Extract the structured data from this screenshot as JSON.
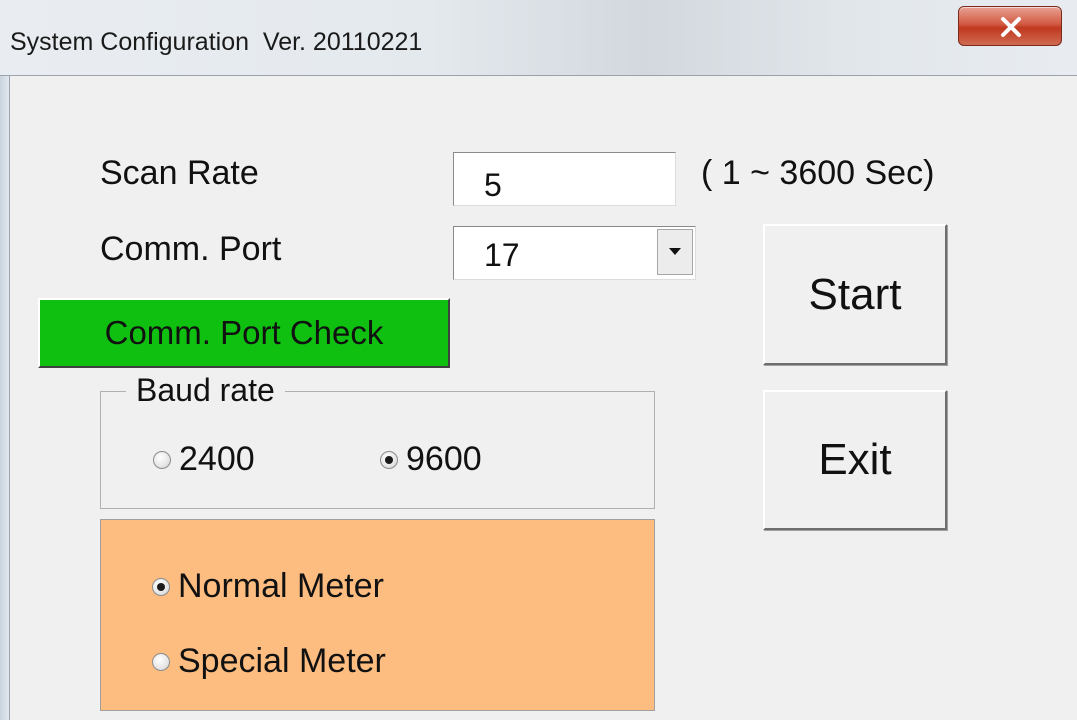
{
  "window": {
    "title": "System Configuration  Ver. 20110221"
  },
  "scan_rate": {
    "label": "Scan Rate",
    "value": "5",
    "range_hint": "( 1 ~ 3600 Sec)"
  },
  "comm_port": {
    "label": "Comm. Port",
    "value": "17",
    "check_button": "Comm. Port Check"
  },
  "baud_rate": {
    "legend": "Baud rate",
    "options": [
      {
        "label": "2400",
        "checked": false
      },
      {
        "label": "9600",
        "checked": true
      }
    ]
  },
  "meter_type": {
    "options": [
      {
        "label": "Normal Meter",
        "checked": true
      },
      {
        "label": "Special Meter",
        "checked": false
      }
    ]
  },
  "buttons": {
    "start": "Start",
    "exit": "Exit"
  },
  "colors": {
    "check_button_bg": "#10c010",
    "meter_panel_bg": "#fdbd80",
    "close_button": "#c0391f"
  },
  "icons": {
    "close": "close-icon",
    "dropdown": "chevron-down-icon"
  }
}
